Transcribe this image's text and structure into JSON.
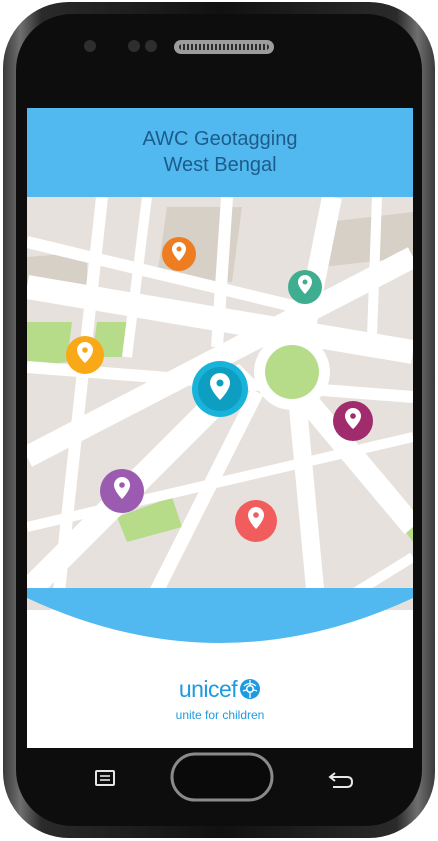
{
  "app": {
    "title_line1": "AWC Geotagging",
    "title_line2": "West Bengal"
  },
  "map": {
    "markers": [
      {
        "name": "marker-orange",
        "color": "#ee7d22"
      },
      {
        "name": "marker-teal",
        "color": "#3fae90"
      },
      {
        "name": "marker-yellow",
        "color": "#f9a818"
      },
      {
        "name": "marker-cyan",
        "color": "#17b3d9"
      },
      {
        "name": "marker-magenta",
        "color": "#a02c6e"
      },
      {
        "name": "marker-purple",
        "color": "#9b5bb0"
      },
      {
        "name": "marker-coral",
        "color": "#f15c5c"
      }
    ]
  },
  "branding": {
    "logo_text": "unicef",
    "tagline": "unite for children",
    "color": "#1c9be0"
  },
  "nav_bar": {
    "menu_icon": "menu-icon",
    "home_icon": "home-button",
    "back_icon": "back-arrow-icon"
  }
}
